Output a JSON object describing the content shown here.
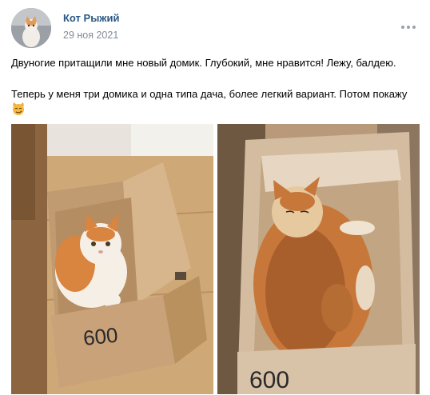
{
  "post": {
    "author": "Кот Рыжий",
    "date": "29 ноя 2021",
    "text_line1": "Двуногие притащили мне новый домик. Глубокий, мне нравится! Лежу, балдею.",
    "text_line2": "Теперь у меня три домика и одна типа дача, более легкий вариант. Потом покажу",
    "emoji_name": "smirk-cat-emoji",
    "more_icon": "more-horizontal-icon",
    "box_label_1": "600",
    "box_label_2": "600"
  },
  "colors": {
    "author_link": "#2a5885",
    "meta_text": "#818c99",
    "cardboard": "#c9a27a",
    "cat_orange": "#d9843f"
  }
}
